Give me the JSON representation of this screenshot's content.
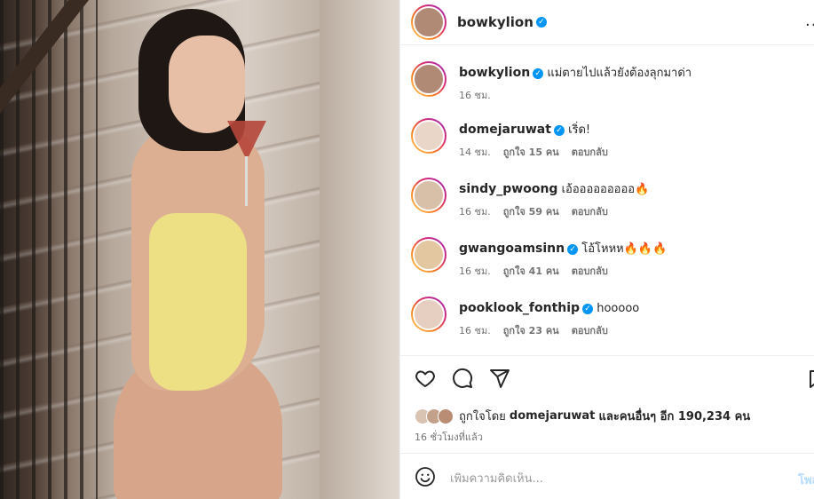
{
  "header": {
    "username": "bowkylion",
    "more_label": "..."
  },
  "comments": [
    {
      "username": "bowkylion",
      "verified": true,
      "text": "แม่ตายไปแล้วยังต้องลุกมาด่า",
      "time": "16 ชม.",
      "likes": "",
      "reply": ""
    },
    {
      "username": "domejaruwat",
      "verified": true,
      "text": "เริ่ด!",
      "time": "14 ชม.",
      "likes": "ถูกใจ 15 คน",
      "reply": "ตอบกลับ"
    },
    {
      "username": "sindy_pwoong",
      "verified": false,
      "text": "เอ้อออออออออ🔥",
      "time": "16 ชม.",
      "likes": "ถูกใจ 59 คน",
      "reply": "ตอบกลับ"
    },
    {
      "username": "gwangoamsinn",
      "verified": true,
      "text": "โอ้โหหห🔥🔥🔥",
      "time": "16 ชม.",
      "likes": "ถูกใจ 41 คน",
      "reply": "ตอบกลับ"
    },
    {
      "username": "pooklook_fonthip",
      "verified": true,
      "text": "hooooo",
      "time": "16 ชม.",
      "likes": "ถูกใจ 23 คน",
      "reply": "ตอบกลับ"
    }
  ],
  "likes": {
    "prefix": "ถูกใจโดย",
    "user": "domejaruwat",
    "middle": "และ",
    "others": "คนอื่นๆ อีก 190,234 คน"
  },
  "post_time": "16 ชั่วโมงที่แล้ว",
  "add_comment": {
    "placeholder": "เพิ่มความคิดเห็น...",
    "post_label": "โพสต์"
  },
  "icons": {
    "like": "heart-icon",
    "comment": "comment-icon",
    "share": "share-icon",
    "save": "bookmark-icon",
    "emoji": "emoji-icon"
  },
  "colors": {
    "verified": "#0095f6",
    "text": "#262626",
    "secondary": "#737373",
    "post_link": "#b3dbff"
  }
}
